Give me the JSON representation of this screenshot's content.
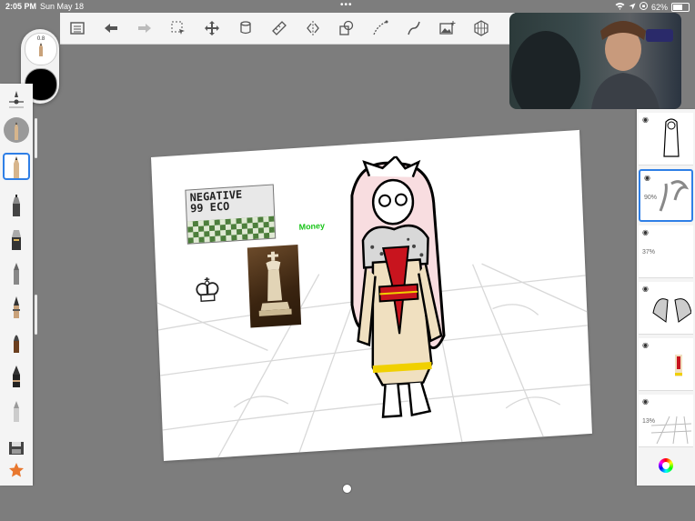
{
  "status_bar": {
    "time": "2:05 PM",
    "date": "Sun May 18",
    "battery": "62%",
    "battery_level": 0.62
  },
  "toolbar": {
    "buttons": [
      {
        "name": "layers-list-button",
        "icon": "list-icon"
      },
      {
        "name": "undo-button",
        "icon": "undo-arrow-icon"
      },
      {
        "name": "redo-button",
        "icon": "redo-arrow-icon"
      },
      {
        "name": "select-button",
        "icon": "marquee-select-icon"
      },
      {
        "name": "transform-button",
        "icon": "move-arrows-icon"
      },
      {
        "name": "fill-button",
        "icon": "paint-bucket-icon"
      },
      {
        "name": "ruler-button",
        "icon": "ruler-icon"
      },
      {
        "name": "symmetry-button",
        "icon": "symmetry-icon"
      },
      {
        "name": "shapes-button",
        "icon": "shapes-icon"
      },
      {
        "name": "perspective-stroke-button",
        "icon": "stroke-curve-icon"
      },
      {
        "name": "predictive-stroke-button",
        "icon": "s-curve-icon"
      },
      {
        "name": "import-image-button",
        "icon": "image-add-icon"
      },
      {
        "name": "perspective-grid-button",
        "icon": "grid-cube-icon"
      }
    ]
  },
  "puck": {
    "size_label": "0.8",
    "color": "#000000"
  },
  "tools": [
    {
      "name": "tool-size-slider",
      "icon": "slider-icon"
    },
    {
      "name": "tool-pencil-round",
      "icon": "pencil-round-icon"
    },
    {
      "name": "tool-pencil",
      "icon": "pencil-icon",
      "active": true
    },
    {
      "name": "tool-ink-pen",
      "icon": "ink-pen-icon"
    },
    {
      "name": "tool-marker",
      "icon": "marker-icon"
    },
    {
      "name": "tool-airbrush",
      "icon": "airbrush-icon"
    },
    {
      "name": "tool-fountain-pen",
      "icon": "fountain-pen-icon"
    },
    {
      "name": "tool-brush",
      "icon": "brush-icon"
    },
    {
      "name": "tool-calligraphy",
      "icon": "calligraphy-icon"
    },
    {
      "name": "tool-eraser",
      "icon": "eraser-icon"
    },
    {
      "name": "tool-save",
      "icon": "save-icon"
    },
    {
      "name": "tool-favorites",
      "icon": "star-icon"
    }
  ],
  "canvas": {
    "sticker_text_line1": "NEGATIVE",
    "sticker_text_line2": "99 ECO",
    "money_label": "Money",
    "king_glyph": "♔"
  },
  "layers": [
    {
      "name": "layer-sketch",
      "opacity": ""
    },
    {
      "name": "layer-hair",
      "opacity": "90%",
      "selected": true
    },
    {
      "name": "layer-empty",
      "opacity": "37%"
    },
    {
      "name": "layer-fur-pattern",
      "opacity": ""
    },
    {
      "name": "layer-color",
      "opacity": ""
    },
    {
      "name": "layer-grid",
      "opacity": "13%"
    }
  ],
  "colors": {
    "accent": "#2f7fe6",
    "money": "#18c418",
    "robe_red": "#c8141e",
    "robe_gold": "#f0d000",
    "robe_cream": "#f0e0c0",
    "hair_pink": "#f8dde0"
  }
}
